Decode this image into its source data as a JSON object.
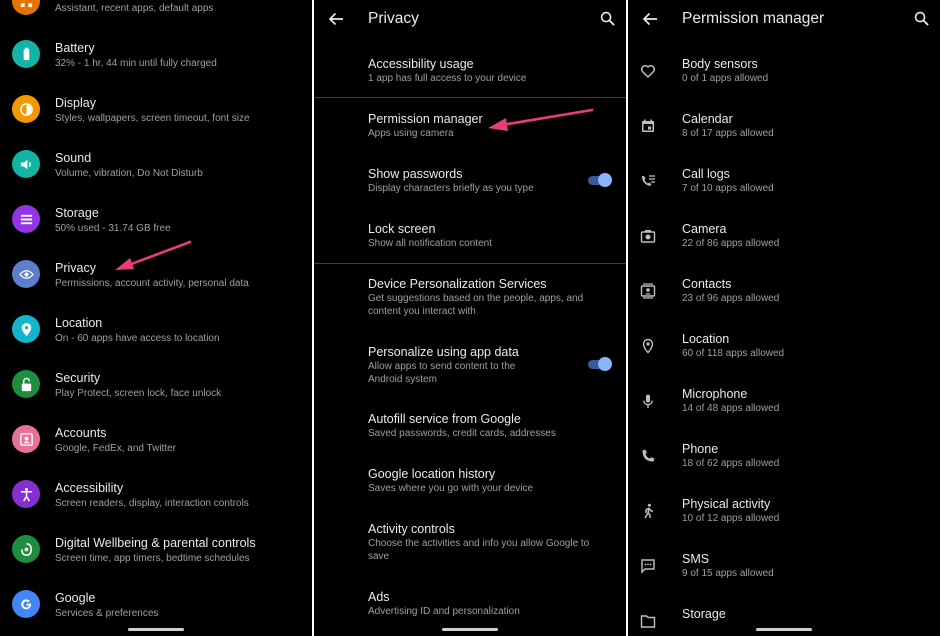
{
  "settings": {
    "items": [
      {
        "title": "",
        "subtitle": "Assistant, recent apps, default apps",
        "color": "#e37400",
        "icon": "apps-icon"
      },
      {
        "title": "Battery",
        "subtitle": "32% - 1 hr, 44 min until fully charged",
        "color": "#12b5a5",
        "icon": "battery-icon"
      },
      {
        "title": "Display",
        "subtitle": "Styles, wallpapers, screen timeout, font size",
        "color": "#f29900",
        "icon": "brightness-icon"
      },
      {
        "title": "Sound",
        "subtitle": "Volume, vibration, Do Not Disturb",
        "color": "#12b5a5",
        "icon": "volume-icon"
      },
      {
        "title": "Storage",
        "subtitle": "50% used - 31.74 GB free",
        "color": "#9334e6",
        "icon": "storage-icon"
      },
      {
        "title": "Privacy",
        "subtitle": "Permissions, account activity, personal data",
        "color": "#5b7fcc",
        "icon": "privacy-eye-icon"
      },
      {
        "title": "Location",
        "subtitle": "On - 60 apps have access to location",
        "color": "#12b5cb",
        "icon": "location-pin-icon"
      },
      {
        "title": "Security",
        "subtitle": "Play Protect, screen lock, face unlock",
        "color": "#1e8e3e",
        "icon": "lock-open-icon"
      },
      {
        "title": "Accounts",
        "subtitle": "Google, FedEx, and Twitter",
        "color": "#e8719a",
        "icon": "account-box-icon"
      },
      {
        "title": "Accessibility",
        "subtitle": "Screen readers, display, interaction controls",
        "color": "#8430ce",
        "icon": "accessibility-icon"
      },
      {
        "title": "Digital Wellbeing & parental controls",
        "subtitle": "Screen time, app timers, bedtime schedules",
        "color": "#1e8e3e",
        "icon": "wellbeing-icon"
      },
      {
        "title": "Google",
        "subtitle": "Services & preferences",
        "color": "#4285f4",
        "icon": "google-g-icon"
      }
    ]
  },
  "privacy": {
    "title": "Privacy",
    "items": [
      {
        "title": "Accessibility usage",
        "subtitle": "1 app has full access to your device"
      },
      {
        "title": "Permission manager",
        "subtitle": "Apps using camera"
      },
      {
        "title": "Show passwords",
        "subtitle": "Display characters briefly as you type",
        "toggle": true
      },
      {
        "title": "Lock screen",
        "subtitle": "Show all notification content"
      },
      {
        "title": "Device Personalization Services",
        "subtitle": "Get suggestions based on the people, apps, and content you interact with"
      },
      {
        "title": "Personalize using app data",
        "subtitle": "Allow apps to send content to the Android system",
        "toggle": true
      },
      {
        "title": "Autofill service from Google",
        "subtitle": "Saved passwords, credit cards, addresses"
      },
      {
        "title": "Google location history",
        "subtitle": "Saves where you go with your device"
      },
      {
        "title": "Activity controls",
        "subtitle": "Choose the activities and info you allow Google to save"
      },
      {
        "title": "Ads",
        "subtitle": "Advertising ID and personalization"
      }
    ]
  },
  "permissions": {
    "title": "Permission manager",
    "items": [
      {
        "title": "Body sensors",
        "subtitle": "0 of 1 apps allowed",
        "icon": "heart-icon"
      },
      {
        "title": "Calendar",
        "subtitle": "8 of 17 apps allowed",
        "icon": "calendar-icon"
      },
      {
        "title": "Call logs",
        "subtitle": "7 of 10 apps allowed",
        "icon": "call-log-icon"
      },
      {
        "title": "Camera",
        "subtitle": "22 of 86 apps allowed",
        "icon": "camera-icon"
      },
      {
        "title": "Contacts",
        "subtitle": "23 of 96 apps allowed",
        "icon": "contacts-icon"
      },
      {
        "title": "Location",
        "subtitle": "60 of 118 apps allowed",
        "icon": "location-pin-icon"
      },
      {
        "title": "Microphone",
        "subtitle": "14 of 48 apps allowed",
        "icon": "microphone-icon"
      },
      {
        "title": "Phone",
        "subtitle": "18 of 62 apps allowed",
        "icon": "phone-icon"
      },
      {
        "title": "Physical activity",
        "subtitle": "10 of 12 apps allowed",
        "icon": "walking-icon"
      },
      {
        "title": "SMS",
        "subtitle": "9 of 15 apps allowed",
        "icon": "sms-icon"
      },
      {
        "title": "Storage",
        "subtitle": "",
        "icon": "folder-icon"
      }
    ]
  },
  "colors": {
    "annotation_arrow": "#ec3a7b",
    "toggle_on": "#8ab4f8"
  }
}
